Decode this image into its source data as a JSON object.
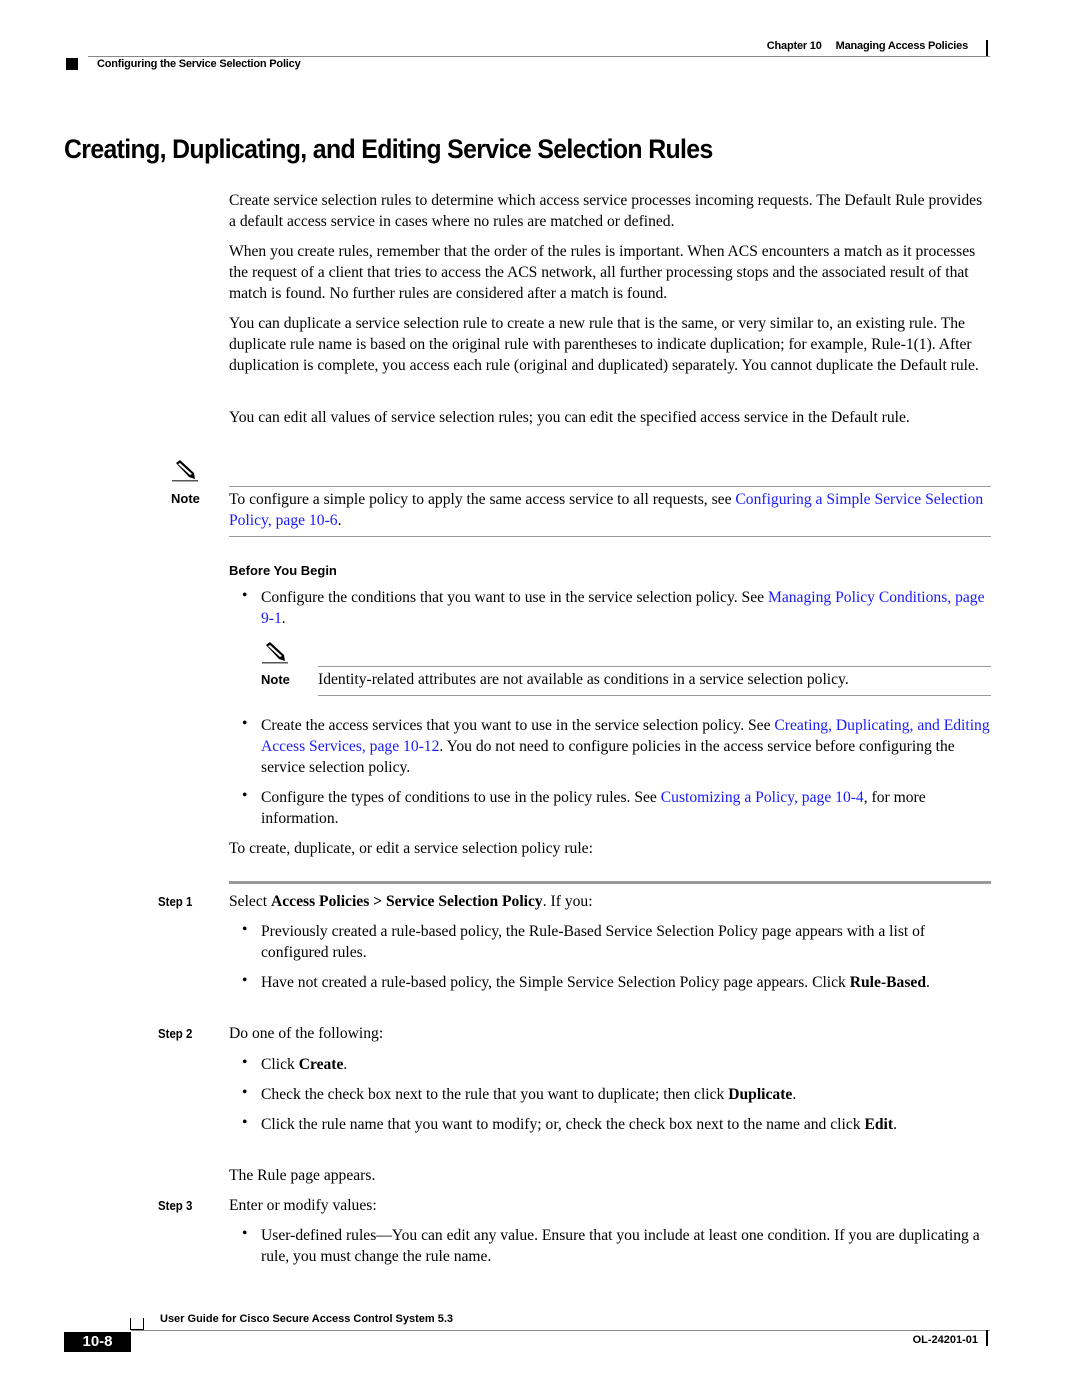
{
  "header": {
    "chapter": "Chapter 10",
    "chapter_title": "Managing Access Policies",
    "section": "Configuring the Service Selection Policy"
  },
  "title": "Creating, Duplicating, and Editing Service Selection Rules",
  "intro": [
    "Create service selection rules to determine which access service processes incoming requests. The Default Rule provides a default access service in cases where no rules are matched or defined.",
    "When you create rules, remember that the order of the rules is important. When ACS encounters a match as it processes the request of a client that tries to access the ACS network, all further processing stops and the associated result of that match is found. No further rules are considered after a match is found.",
    "You can duplicate a service selection rule to create a new rule that is the same, or very similar to, an existing rule. The duplicate rule name is based on the original rule with parentheses to indicate duplication; for example, Rule-1(1). After duplication is complete, you access each rule (original and duplicated) separately. You cannot duplicate the Default rule.",
    "You can edit all values of service selection rules; you can edit the specified access service in the Default rule."
  ],
  "note1": {
    "label": "Note",
    "text": "To configure a simple policy to apply the same access service to all requests, see ",
    "link": "Configuring a Simple Service Selection Policy, page 10-6",
    "after": "."
  },
  "before_you_begin": {
    "heading": "Before You Begin",
    "bullet1": {
      "text": "Configure the conditions that you want to use in the service selection policy. See ",
      "link": "Managing Policy Conditions, page 9-1",
      "after": "."
    },
    "note2": {
      "label": "Note",
      "text": "Identity-related attributes are not available as conditions in a service selection policy."
    },
    "bullet2": {
      "text": "Create the access services that you want to use in the service selection policy. See ",
      "link": "Creating, Duplicating, and Editing Access Services, page 10-12",
      "after": ". You do not need to configure policies in the access service before configuring the service selection policy."
    },
    "bullet3": {
      "text": "Configure the types of conditions to use in the policy rules. See ",
      "link": "Customizing a Policy, page 10-4",
      "after": ", for more information."
    },
    "lead": "To create, duplicate, or edit a service selection policy rule:"
  },
  "steps": [
    {
      "label": "Step 1",
      "pre": "Select ",
      "bold": "Access Policies > Service Selection Policy",
      "post": ". If you:",
      "bullets": [
        {
          "text": "Previously created a rule-based policy, the Rule-Based Service Selection Policy page appears with a list of configured rules."
        },
        {
          "text": "Have not created a rule-based policy, the Simple Service Selection Policy page appears. Click ",
          "bold": "Rule-Based",
          "after": "."
        }
      ]
    },
    {
      "label": "Step 2",
      "text": "Do one of the following:",
      "bullets": [
        {
          "text": "Click ",
          "bold": "Create",
          "after": "."
        },
        {
          "text": "Check the check box next to the rule that you want to duplicate; then click ",
          "bold": "Duplicate",
          "after": "."
        },
        {
          "text": "Click the rule name that you want to modify; or, check the check box next to the name and click ",
          "bold": "Edit",
          "after": "."
        }
      ],
      "result": "The Rule page appears."
    },
    {
      "label": "Step 3",
      "text": "Enter or modify values:",
      "bullets": [
        {
          "text": "User-defined rules—You can edit any value. Ensure that you include at least one condition. If you are duplicating a rule, you must change the rule name."
        }
      ]
    }
  ],
  "footer": {
    "guide_title": "User Guide for Cisco Secure Access Control System 5.3",
    "page_number": "10-8",
    "doc_id": "OL-24201-01"
  }
}
